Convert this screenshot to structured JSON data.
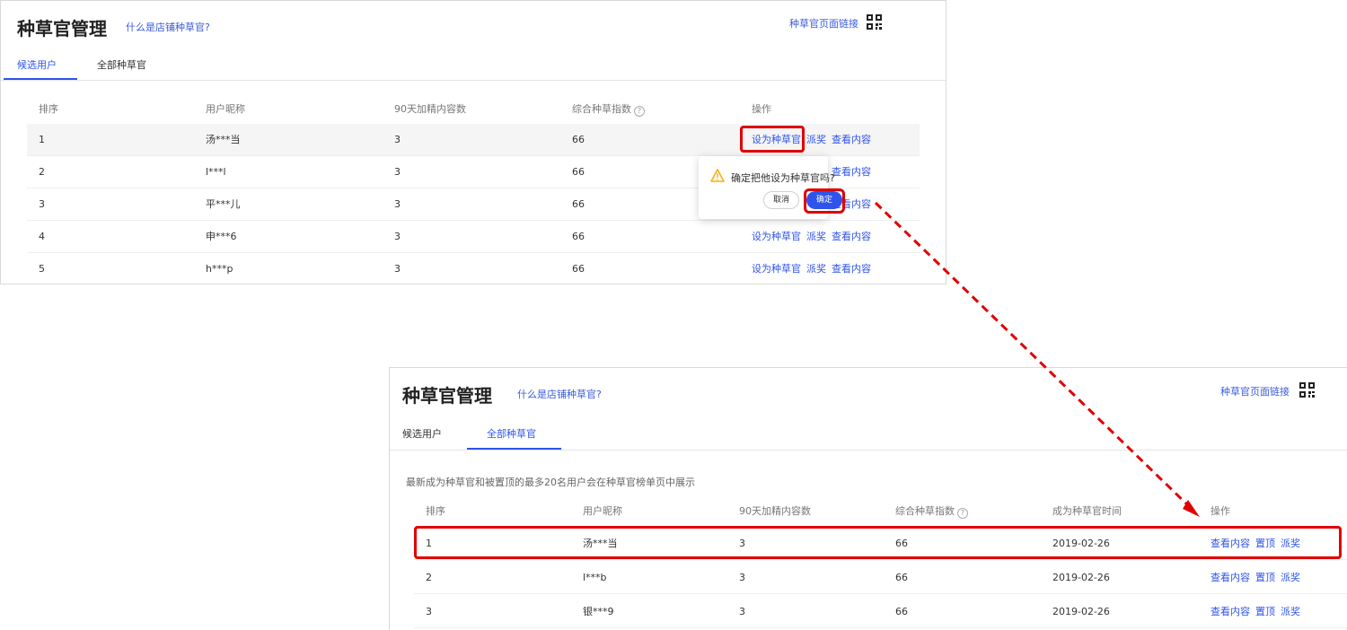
{
  "panel1": {
    "title": "种草官管理",
    "help_link": "什么是店铺种草官?",
    "page_link": "种草官页面链接",
    "tabs": [
      {
        "label": "候选用户",
        "active": true
      },
      {
        "label": "全部种草官",
        "active": false
      }
    ],
    "columns": [
      "排序",
      "用户昵称",
      "90天加精内容数",
      "综合种草指数",
      "操作"
    ],
    "rows": [
      {
        "rank": "1",
        "nickname": "汤***当",
        "count": "3",
        "index": "66"
      },
      {
        "rank": "2",
        "nickname": "l***l",
        "count": "3",
        "index": "66"
      },
      {
        "rank": "3",
        "nickname": "平***儿",
        "count": "3",
        "index": "66"
      },
      {
        "rank": "4",
        "nickname": "申***6",
        "count": "3",
        "index": "66"
      },
      {
        "rank": "5",
        "nickname": "h***p",
        "count": "3",
        "index": "66"
      }
    ],
    "actions": {
      "set": "设为种草官",
      "award": "派奖",
      "view": "查看内容"
    },
    "popconfirm": {
      "message": "确定把他设为种草官吗?",
      "cancel": "取消",
      "confirm": "确定"
    }
  },
  "panel2": {
    "title": "种草官管理",
    "help_link": "什么是店铺种草官?",
    "page_link": "种草官页面链接",
    "tabs": [
      {
        "label": "候选用户",
        "active": false
      },
      {
        "label": "全部种草官",
        "active": true
      }
    ],
    "notice": "最新成为种草官和被置顶的最多20名用户会在种草官榜单页中展示",
    "columns": [
      "排序",
      "用户昵称",
      "90天加精内容数",
      "综合种草指数",
      "成为种草官时间",
      "操作"
    ],
    "rows": [
      {
        "rank": "1",
        "nickname": "汤***当",
        "count": "3",
        "index": "66",
        "date": "2019-02-26"
      },
      {
        "rank": "2",
        "nickname": "l***b",
        "count": "3",
        "index": "66",
        "date": "2019-02-26"
      },
      {
        "rank": "3",
        "nickname": "银***9",
        "count": "3",
        "index": "66",
        "date": "2019-02-26"
      }
    ],
    "actions": {
      "view": "查看内容",
      "pin": "置顶",
      "award": "派奖"
    }
  },
  "colors": {
    "accent": "#2f54eb",
    "highlight": "#e00000",
    "warning": "#faad14"
  },
  "icons": {
    "qr": "qr-code-icon",
    "help": "question-circle-icon",
    "warning": "warning-icon"
  }
}
